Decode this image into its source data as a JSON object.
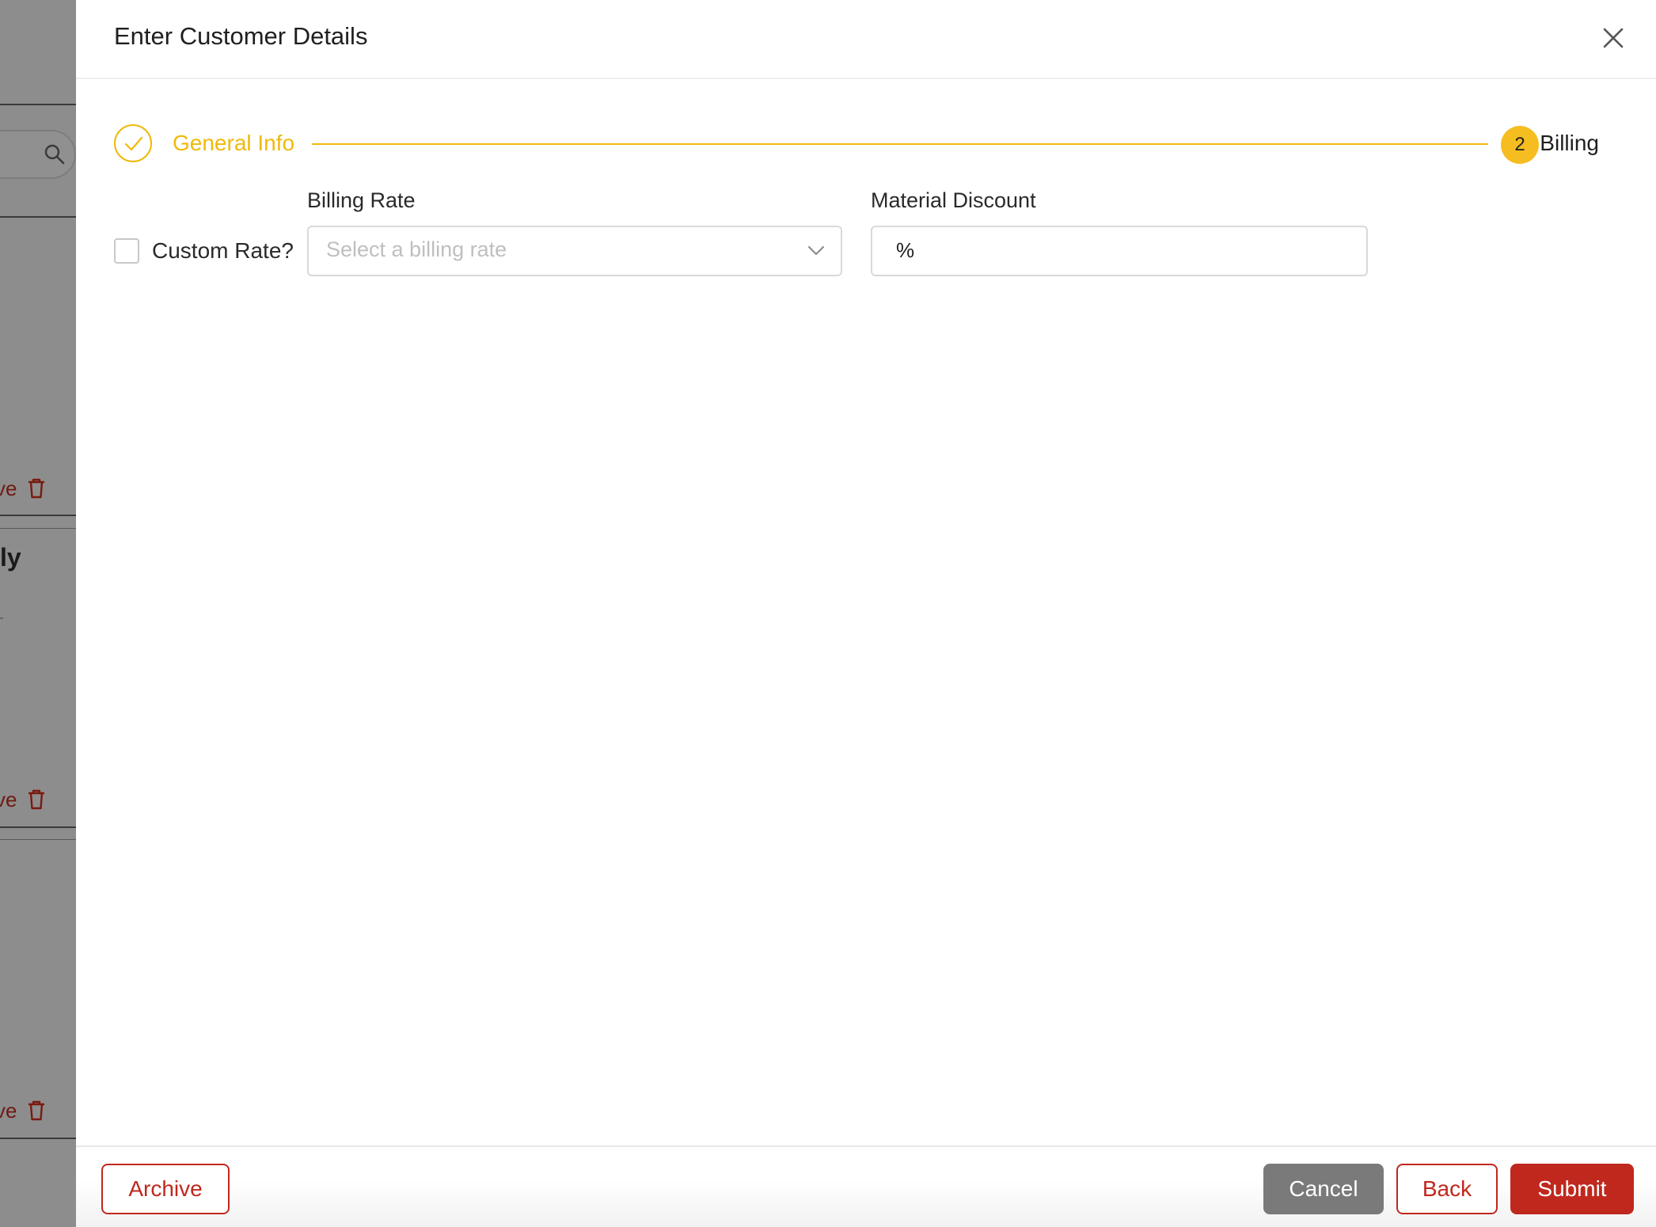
{
  "background": {
    "remove_fragment": "ve",
    "bold_fragment": "ly"
  },
  "modal": {
    "title": "Enter Customer Details",
    "steps": [
      {
        "label": "General Info",
        "status": "completed"
      },
      {
        "number": "2",
        "label": "Billing",
        "status": "current"
      }
    ],
    "form": {
      "custom_rate_label": "Custom Rate?",
      "custom_rate_checked": false,
      "billing_rate_label": "Billing Rate",
      "billing_rate_placeholder": "Select a billing rate",
      "material_discount_label": "Material Discount",
      "material_discount_prefix": "%",
      "material_discount_value": ""
    },
    "footer": {
      "archive_label": "Archive",
      "cancel_label": "Cancel",
      "back_label": "Back",
      "submit_label": "Submit"
    }
  },
  "colors": {
    "accent_yellow": "#f0b90b",
    "step_circle_yellow": "#f5bd1f",
    "brand_red": "#c0281d",
    "cancel_gray": "#7a7a7a",
    "overlay_gray": "#8d8d8d"
  },
  "icons": {
    "close": "close-icon",
    "step_done": "check-icon",
    "select_chevron": "chevron-down-icon",
    "bg_search": "search-icon",
    "bg_delete": "trash-icon"
  }
}
